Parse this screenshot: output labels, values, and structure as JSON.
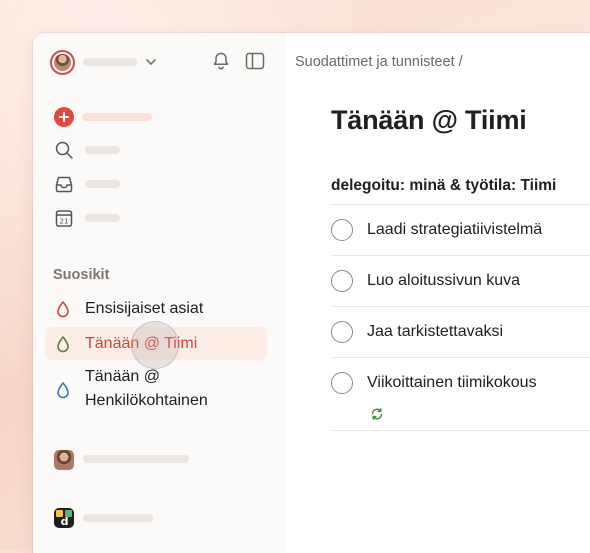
{
  "header": {
    "breadcrumb": "Suodattimet ja tunnisteet /"
  },
  "sidebar": {
    "section_title": "Suosikit",
    "favorites": [
      {
        "label": "Ensisijaiset asiat",
        "icon": "drop-icon",
        "color": "#d1453b"
      },
      {
        "label": "Tänään @ Tiimi",
        "icon": "drop-icon",
        "color": "#6b7c3a",
        "active": true
      },
      {
        "label": "Tänään @ Henkilökohtainen",
        "label_line1": "Tänään @",
        "label_line2": "Henkilökohtainen",
        "icon": "drop-icon",
        "color": "#2f7ec2"
      }
    ]
  },
  "main": {
    "title": "Tänään @ Tiimi",
    "group_header": "delegoitu: minä & työtila: Tiimi",
    "tasks": [
      {
        "label": "Laadi strategiatiivistelmä"
      },
      {
        "label": "Luo aloitussivun kuva"
      },
      {
        "label": "Jaa tarkistettavaksi"
      },
      {
        "label": "Viikoittainen tiimikokous",
        "recurring": true
      }
    ]
  },
  "colors": {
    "accent": "#e0493d",
    "active_text": "#d1453b",
    "active_bg": "#fcece6",
    "sidebar_bg": "#fcfaf8",
    "recurring_icon": "#3a8f3a"
  }
}
